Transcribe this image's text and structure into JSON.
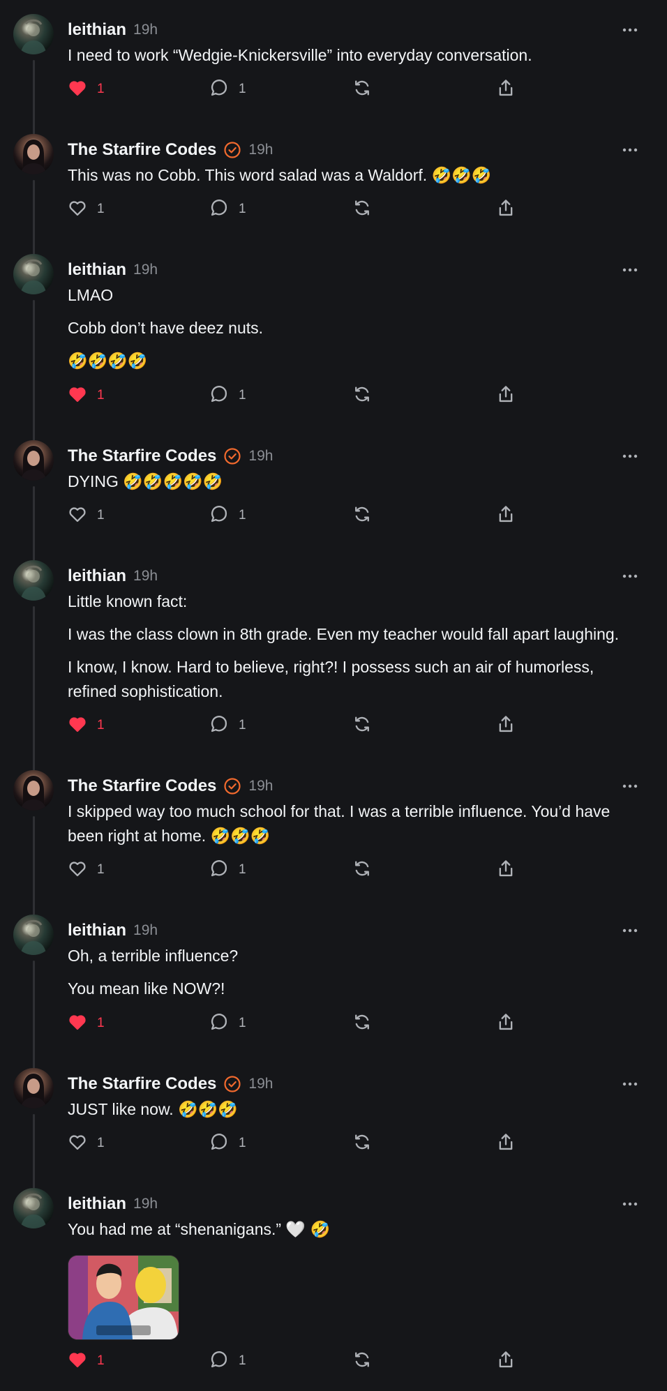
{
  "posts": [
    {
      "user": "leithian",
      "verified": false,
      "time": "19h",
      "paragraphs": [
        "I need to work “Wedgie-Knickersville” into everyday conversation."
      ],
      "liked": true,
      "likes": "1",
      "replies": "1"
    },
    {
      "user": "The Starfire Codes",
      "verified": true,
      "time": "19h",
      "paragraphs": [
        "This was no Cobb. This word salad was a Waldorf. 🤣🤣🤣"
      ],
      "liked": false,
      "likes": "1",
      "replies": "1"
    },
    {
      "user": "leithian",
      "verified": false,
      "time": "19h",
      "paragraphs": [
        "LMAO",
        "Cobb don’t have deez nuts.",
        "🤣🤣🤣🤣"
      ],
      "liked": true,
      "likes": "1",
      "replies": "1"
    },
    {
      "user": "The Starfire Codes",
      "verified": true,
      "time": "19h",
      "paragraphs": [
        "DYING 🤣🤣🤣🤣🤣"
      ],
      "liked": false,
      "likes": "1",
      "replies": "1"
    },
    {
      "user": "leithian",
      "verified": false,
      "time": "19h",
      "paragraphs": [
        "Little known fact:",
        "I was the class clown in 8th grade. Even my teacher would fall apart laughing.",
        "I know, I know. Hard to believe, right?! I possess such an air of humorless, refined sophistication."
      ],
      "liked": true,
      "likes": "1",
      "replies": "1"
    },
    {
      "user": "The Starfire Codes",
      "verified": true,
      "time": "19h",
      "paragraphs": [
        "I skipped way too much school for that. I was a terrible influence. You’d have been right at home. 🤣🤣🤣"
      ],
      "liked": false,
      "likes": "1",
      "replies": "1"
    },
    {
      "user": "leithian",
      "verified": false,
      "time": "19h",
      "paragraphs": [
        "Oh, a terrible influence?",
        "You mean like NOW?!"
      ],
      "liked": true,
      "likes": "1",
      "replies": "1"
    },
    {
      "user": "The Starfire Codes",
      "verified": true,
      "time": "19h",
      "paragraphs": [
        "JUST like now. 🤣🤣🤣"
      ],
      "liked": false,
      "likes": "1",
      "replies": "1"
    },
    {
      "user": "leithian",
      "verified": false,
      "time": "19h",
      "paragraphs": [
        "You had me at “shenanigans.” 🤍 🤣"
      ],
      "has_image": true,
      "liked": true,
      "likes": "1",
      "replies": "1"
    }
  ],
  "icons": {
    "like": "heart-icon",
    "reply": "comment-bubble-icon",
    "repost": "repost-icon",
    "share": "share-icon",
    "more": "more-horizontal-icon",
    "verified": "verified-badge-icon"
  },
  "colors": {
    "background": "#151619",
    "text": "#f3f5f7",
    "muted": "#8b8e94",
    "like": "#ff3850",
    "verified": "#f26a2e"
  }
}
